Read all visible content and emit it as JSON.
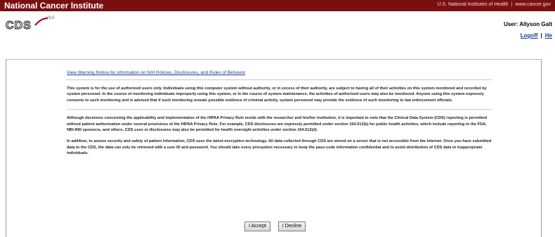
{
  "nci_bar": {
    "title": "National Cancer Institute",
    "link_nih": "U.S. National Institutes of Health",
    "link_site": "www.cancer.gov"
  },
  "header": {
    "logo_text": "CDS",
    "logo_sup": "v3.0",
    "user_label": "User: Allyson Galt",
    "logoff": "Logoff",
    "help": "He"
  },
  "notice": {
    "warning_link": "View Warning Notice for information on NIH Policies, Disclosures, and Rules of Behavior",
    "para1": "This system is for the use of authorized users only. Individuals using this computer system without authority, or in excess of their authority, are subject to having all of their activities on this system monitored and recorded by system personnel. In the course of monitoring individuals improperly using this system, or in the course of system maintenance, the activities of authorized users may also be monitored. Anyone using this system expressly consents to such monitoring and is advised that if such monitoring reveals possible evidence of criminal activity, system personnel may provide the evidence of such monitoring to law enforcement officials.",
    "para2": "Although decisions concerning the applicability and implementation of the HIPAA Privacy Rule reside with the researcher and his/her institution, it is important to note that the Clinical Data System (CDS) reporting is permitted without patient authorization under several provisions of the HIPAA Privacy Rule. For example, CDS disclosures are expressly permitted under section 164.512(b) for public health activities, which include reporting to the FDA, NBI-IND sponsors, and others.   CDS uses or disclosures may also be permitted for health oversight activities under section 164.512(d).",
    "para3": "In addition, to assure security and safety of patient information, CDS uses the latest encryption technology. All data collected through CDS are stored on a server that is not accessible from the Internet. Once you have submitted data to the CDS, the data can only be retrieved with a user ID and password. You should take every precaution necessary to keep the pass-code information confidential and to avoid distribution of CDS data to inappropriate individuals."
  },
  "buttons": {
    "accept": "I Accept",
    "decline": "I Decline"
  },
  "colors": {
    "nci_bar": "#7a0f12",
    "link": "#1a3a9e"
  }
}
